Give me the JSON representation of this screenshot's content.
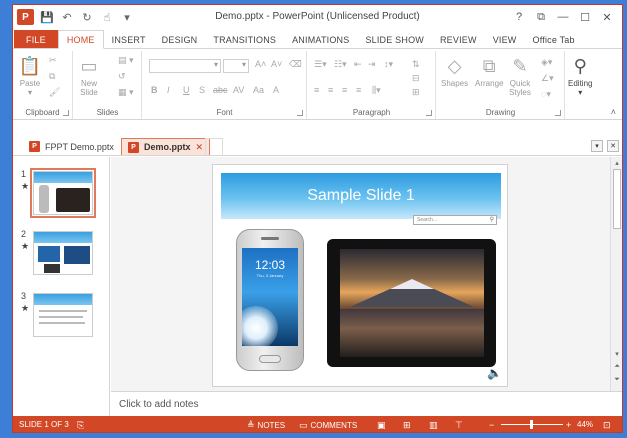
{
  "window": {
    "title": "Demo.pptx - PowerPoint (Unlicensed Product)",
    "logo": "P",
    "controls": [
      "?",
      "⧉",
      "—",
      "☐",
      "✕"
    ]
  },
  "ribbon_tabs": [
    "FILE",
    "HOME",
    "INSERT",
    "DESIGN",
    "TRANSITIONS",
    "ANIMATIONS",
    "SLIDE SHOW",
    "REVIEW",
    "VIEW",
    "Office Tab"
  ],
  "ribbon": {
    "clipboard": {
      "label": "Clipboard",
      "paste": "Paste"
    },
    "slides": {
      "label": "Slides",
      "new_slide": "New\nSlide"
    },
    "font": {
      "label": "Font",
      "format_buttons": [
        "B",
        "I",
        "U",
        "S",
        "abc",
        "AV",
        "Aa",
        "A"
      ]
    },
    "paragraph": {
      "label": "Paragraph"
    },
    "drawing": {
      "label": "Drawing",
      "shapes": "Shapes",
      "arrange": "Arrange",
      "quick_styles": "Quick\nStyles"
    },
    "editing": {
      "label": "Editing"
    }
  },
  "doc_tabs": [
    {
      "label": "FPPT Demo.pptx"
    },
    {
      "label": "Demo.pptx",
      "active": true
    }
  ],
  "thumbnails": [
    {
      "num": "1",
      "star": "★"
    },
    {
      "num": "2",
      "star": "★"
    },
    {
      "num": "3",
      "star": "★"
    }
  ],
  "slide": {
    "title": "Sample Slide 1",
    "search_placeholder": "Search...",
    "phone_time": "12:03",
    "phone_date": "Thu, 3 January"
  },
  "notes_placeholder": "Click to add notes",
  "status": {
    "slide_info": "SLIDE 1 OF 3",
    "notes": "NOTES",
    "comments": "COMMENTS",
    "zoom": "44%"
  }
}
